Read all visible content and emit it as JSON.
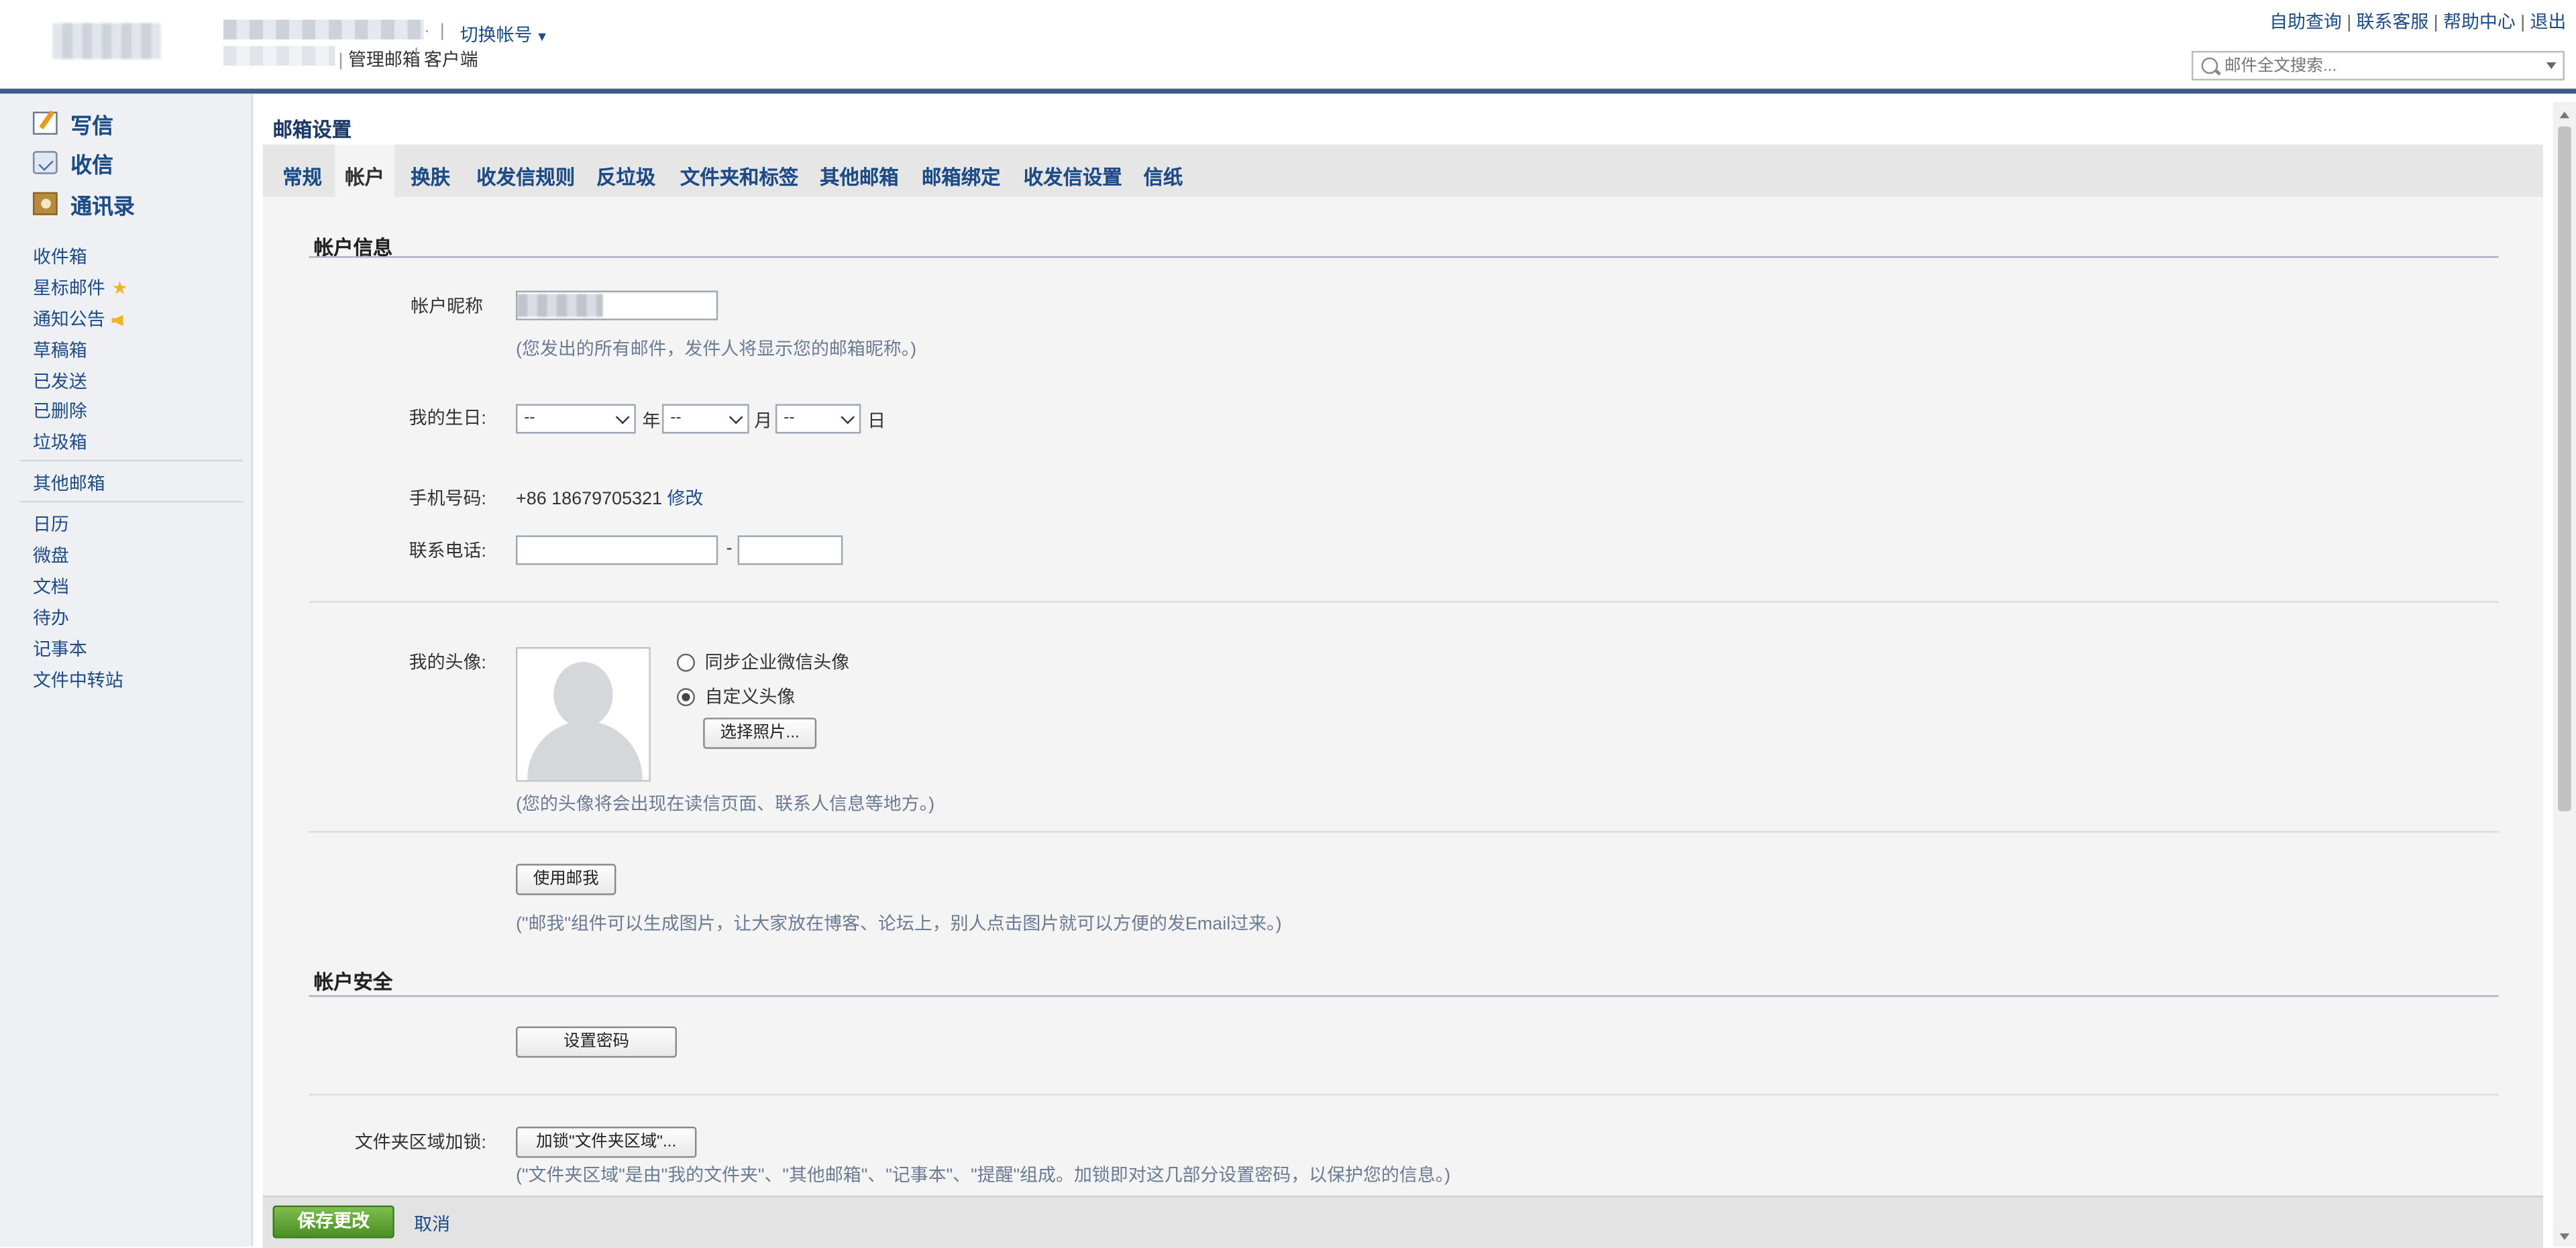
{
  "header": {
    "switch_account": "切换帐号",
    "sub_links": [
      "管理邮箱",
      "客户端"
    ],
    "sub_sep": "|",
    "top_links": [
      "自助查询",
      "联系客服",
      "帮助中心",
      "退出"
    ],
    "search_placeholder": "邮件全文搜索..."
  },
  "sidebar": {
    "write": "写信",
    "receive": "收信",
    "contacts": "通讯录",
    "folders": [
      "收件箱",
      "星标邮件",
      "通知公告",
      "草稿箱",
      "已发送",
      "已删除",
      "垃圾箱"
    ],
    "other_mailbox": "其他邮箱",
    "apps": [
      "日历",
      "微盘",
      "文档",
      "待办",
      "记事本",
      "文件中转站"
    ]
  },
  "main": {
    "title": "邮箱设置",
    "tabs": [
      "常规",
      "帐户",
      "换肤",
      "收发信规则",
      "反垃圾",
      "文件夹和标签",
      "其他邮箱",
      "邮箱绑定",
      "收发信设置",
      "信纸"
    ],
    "active_tab": "帐户"
  },
  "account_info": {
    "section_title": "帐户信息",
    "nickname_label": "帐户昵称",
    "nickname_hint": "(您发出的所有邮件，发件人将显示您的邮箱昵称。)",
    "birthday_label": "我的生日:",
    "birthday_year": "--",
    "birthday_month": "--",
    "birthday_day": "--",
    "year_unit": "年",
    "month_unit": "月",
    "day_unit": "日",
    "phone_label": "手机号码:",
    "phone_value": "+86 18679705321",
    "phone_modify": "修改",
    "tel_label": "联系电话:",
    "tel_sep": "-",
    "avatar_label": "我的头像:",
    "avatar_opt_sync": "同步企业微信头像",
    "avatar_opt_custom": "自定义头像",
    "choose_photo": "选择照片...",
    "avatar_hint": "(您的头像将会出现在读信页面、联系人信息等地方。)",
    "use_mailme": "使用邮我",
    "mailme_hint": "(\"邮我\"组件可以生成图片，让大家放在博客、论坛上，别人点击图片就可以方便的发Email过来。)"
  },
  "account_security": {
    "section_title": "帐户安全",
    "set_password": "设置密码",
    "folder_lock_label": "文件夹区域加锁:",
    "folder_lock_button": "加锁\"文件夹区域\"...",
    "folder_lock_hint": "(\"文件夹区域\"是由\"我的文件夹\"、\"其他邮箱\"、\"记事本\"、\"提醒\"组成。加锁即对这几部分设置密码，以保护您的信息。)"
  },
  "footer": {
    "save": "保存更改",
    "cancel": "取消"
  }
}
